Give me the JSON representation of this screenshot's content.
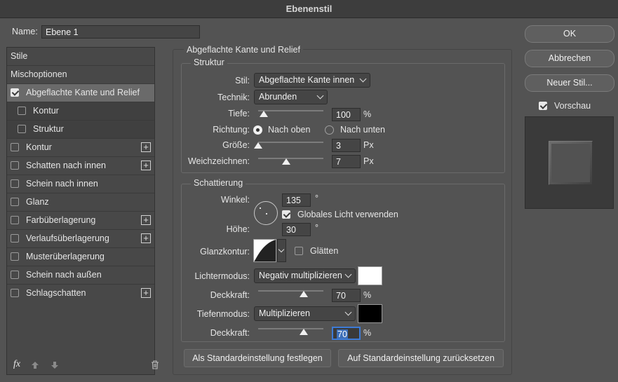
{
  "window": {
    "title": "Ebenenstil"
  },
  "name_field": {
    "label": "Name:",
    "value": "Ebene 1"
  },
  "sidebar": {
    "items": [
      {
        "label": "Stile"
      },
      {
        "label": "Mischoptionen"
      },
      {
        "label": "Abgeflachte Kante und Relief",
        "checked": true,
        "selected": true
      },
      {
        "label": "Kontur",
        "checked": false,
        "sub": true
      },
      {
        "label": "Struktur",
        "checked": false,
        "sub": true
      },
      {
        "label": "Kontur",
        "checked": false,
        "plus": true
      },
      {
        "label": "Schatten nach innen",
        "checked": false,
        "plus": true
      },
      {
        "label": "Schein nach innen",
        "checked": false
      },
      {
        "label": "Glanz",
        "checked": false
      },
      {
        "label": "Farbüberlagerung",
        "checked": false,
        "plus": true
      },
      {
        "label": "Verlaufsüberlagerung",
        "checked": false,
        "plus": true
      },
      {
        "label": "Musterüberlagerung",
        "checked": false
      },
      {
        "label": "Schein nach außen",
        "checked": false
      },
      {
        "label": "Schlagschatten",
        "checked": false,
        "plus": true
      }
    ],
    "footer": {
      "fx_label": "fx",
      "icons": [
        "arrow-up-icon",
        "arrow-down-icon",
        "trash-icon"
      ]
    }
  },
  "panel": {
    "title": "Abgeflachte Kante und Relief",
    "structure": {
      "title": "Struktur",
      "style_label": "Stil:",
      "style_value": "Abgeflachte Kante innen",
      "technique_label": "Technik:",
      "technique_value": "Abrunden",
      "depth_label": "Tiefe:",
      "depth_value": "100",
      "depth_unit": "%",
      "depth_slider": 0.07,
      "direction_label": "Richtung:",
      "direction_up": "Nach oben",
      "direction_down": "Nach unten",
      "direction_selected": "up",
      "size_label": "Größe:",
      "size_value": "3",
      "size_unit": "Px",
      "size_slider": 0.0,
      "soften_label": "Weichzeichnen:",
      "soften_value": "7",
      "soften_unit": "Px",
      "soften_slider": 0.4
    },
    "shading": {
      "title": "Schattierung",
      "angle_label": "Winkel:",
      "angle_value": "135",
      "angle_unit": "°",
      "global_light_label": "Globales Licht verwenden",
      "global_light_checked": true,
      "altitude_label": "Höhe:",
      "altitude_value": "30",
      "altitude_unit": "°",
      "gloss_label": "Glanzkontur:",
      "antialias_label": "Glätten",
      "antialias_checked": false,
      "highlight_mode_label": "Lichtermodus:",
      "highlight_mode_value": "Negativ multiplizieren",
      "highlight_color": "#ffffff",
      "highlight_opacity_label": "Deckkraft:",
      "highlight_opacity_value": "70",
      "highlight_opacity_unit": "%",
      "highlight_opacity_slider": 0.7,
      "shadow_mode_label": "Tiefenmodus:",
      "shadow_mode_value": "Multiplizieren",
      "shadow_color": "#000000",
      "shadow_opacity_label": "Deckkraft:",
      "shadow_opacity_value": "70",
      "shadow_opacity_unit": "%",
      "shadow_opacity_slider": 0.7
    },
    "buttons": {
      "make_default": "Als Standardeinstellung festlegen",
      "reset_default": "Auf Standardeinstellung zurücksetzen"
    }
  },
  "right": {
    "ok": "OK",
    "cancel": "Abbrechen",
    "new_style": "Neuer Stil...",
    "preview_label": "Vorschau",
    "preview_checked": true
  }
}
